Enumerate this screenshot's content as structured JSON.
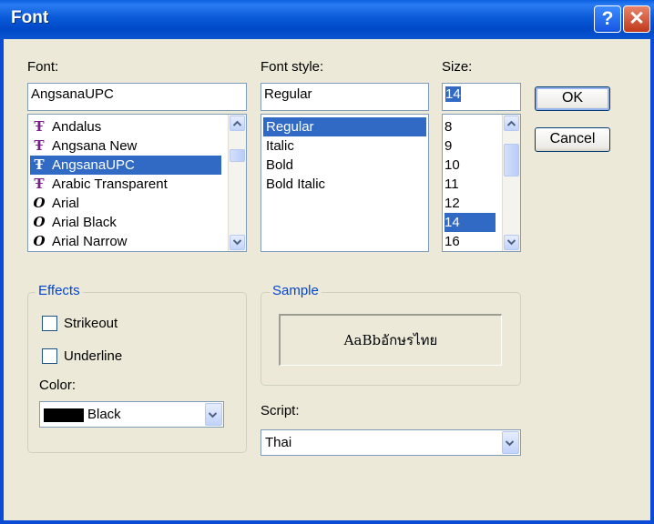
{
  "window": {
    "title": "Font",
    "help_glyph": "?",
    "close_glyph": "✕"
  },
  "font": {
    "label": "Font:",
    "value": "AngsanaUPC",
    "items": [
      {
        "label": "Andalus",
        "icon": "truetype-icon",
        "glyph": "Ŧ"
      },
      {
        "label": "Angsana New",
        "icon": "truetype-icon",
        "glyph": "Ŧ"
      },
      {
        "label": "AngsanaUPC",
        "icon": "truetype-icon",
        "glyph": "Ŧ"
      },
      {
        "label": "Arabic Transparent",
        "icon": "truetype-icon",
        "glyph": "Ŧ"
      },
      {
        "label": "Arial",
        "icon": "opentype-icon",
        "glyph": "O"
      },
      {
        "label": "Arial Black",
        "icon": "opentype-icon",
        "glyph": "O"
      },
      {
        "label": "Arial Narrow",
        "icon": "opentype-icon",
        "glyph": "O"
      }
    ]
  },
  "style": {
    "label": "Font style:",
    "value": "Regular",
    "items": [
      "Regular",
      "Italic",
      "Bold",
      "Bold Italic"
    ]
  },
  "size": {
    "label": "Size:",
    "value": "14",
    "items": [
      "8",
      "9",
      "10",
      "11",
      "12",
      "14",
      "16"
    ]
  },
  "buttons": {
    "ok": "OK",
    "cancel": "Cancel"
  },
  "effects": {
    "legend": "Effects",
    "strikeout": "Strikeout",
    "underline": "Underline",
    "color_label": "Color:",
    "color_value": "Black",
    "color_hex": "#000000"
  },
  "sample": {
    "legend": "Sample",
    "text": "AaBbอักษรไทย"
  },
  "script": {
    "label": "Script:",
    "value": "Thai"
  },
  "colors": {
    "accent": "#0046d5",
    "selection": "#316ac5",
    "titlebar": "#0a5ad8"
  }
}
